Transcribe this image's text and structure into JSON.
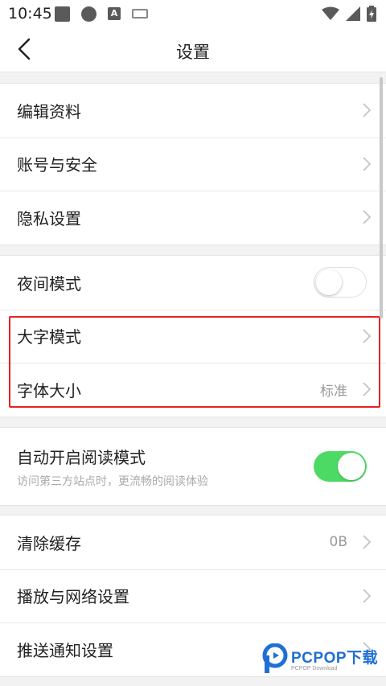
{
  "status_bar": {
    "time": "10:45",
    "a_icon_text": "A"
  },
  "nav": {
    "title": "设置"
  },
  "group1": [
    {
      "label": "编辑资料"
    },
    {
      "label": "账号与安全"
    },
    {
      "label": "隐私设置"
    }
  ],
  "group2": {
    "night_mode": {
      "label": "夜间模式",
      "enabled": false
    },
    "large_text": {
      "label": "大字模式"
    },
    "font_size": {
      "label": "字体大小",
      "value": "标准"
    }
  },
  "group3": {
    "auto_reading": {
      "title": "自动开启阅读模式",
      "subtitle": "访问第三方站点时，更流畅的阅读体验",
      "enabled": true
    }
  },
  "group4": [
    {
      "label": "清除缓存",
      "value": "0B"
    },
    {
      "label": "播放与网络设置"
    },
    {
      "label": "推送通知设置"
    }
  ],
  "watermark": {
    "main": "PCPOP下载",
    "sub": "PCPOP Download"
  },
  "colors": {
    "toggle_on": "#4cd964",
    "highlight": "#e52222",
    "watermark": "#1f6fd6"
  }
}
